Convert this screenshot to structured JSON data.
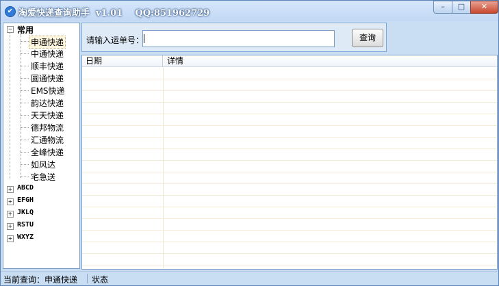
{
  "window": {
    "title": "淘爱快递查询助手  v1.01    QQ:851962729",
    "controls": {
      "minimize": "–",
      "maximize": "□",
      "close": "✕"
    }
  },
  "sidebar": {
    "root": {
      "label": "常用",
      "expander": "−"
    },
    "items": [
      "申通快递",
      "中通快递",
      "顺丰快递",
      "圆通快递",
      "EMS快递",
      "韵达快递",
      "天天快递",
      "德邦物流",
      "汇通物流",
      "全峰快递",
      "如风达",
      "宅急送"
    ],
    "selected_index": 0,
    "categories": [
      {
        "label": "ABCD",
        "expander": "+"
      },
      {
        "label": "EFGH",
        "expander": "+"
      },
      {
        "label": "JKLQ",
        "expander": "+"
      },
      {
        "label": "RSTU",
        "expander": "+"
      },
      {
        "label": "WXYZ",
        "expander": "+"
      }
    ]
  },
  "search": {
    "label": "请输入运单号：",
    "value": "",
    "button": "查询"
  },
  "results": {
    "columns": [
      "日期",
      "详情"
    ],
    "rows": []
  },
  "status": {
    "current": "当前查询：申通快递",
    "state": "状态"
  },
  "colors": {
    "window_bg": "#c9ddf3",
    "close_button": "#c9462c",
    "row_line": "#f2ecd8"
  }
}
